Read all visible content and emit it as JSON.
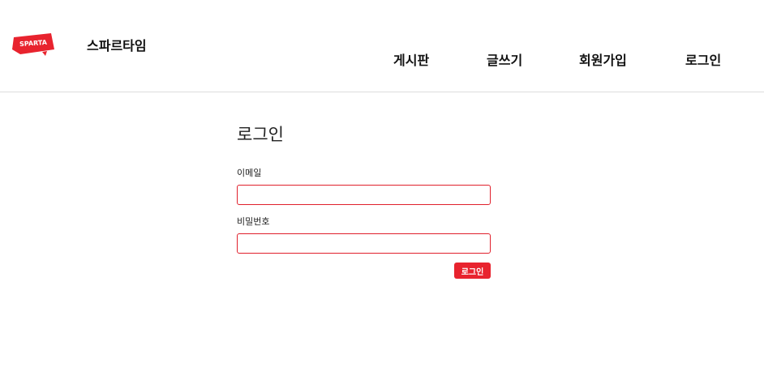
{
  "header": {
    "logo_text": "SPARTA",
    "site_title": "스파르타임",
    "nav": {
      "board": "게시판",
      "write": "글쓰기",
      "signup": "회원가입",
      "login": "로그인"
    }
  },
  "login_form": {
    "title": "로그인",
    "email_label": "이메일",
    "email_value": "",
    "password_label": "비밀번호",
    "password_value": "",
    "submit_label": "로그인"
  },
  "colors": {
    "accent": "#e8232e",
    "input_border": "#e0202c",
    "divider": "#dcdcdc"
  }
}
